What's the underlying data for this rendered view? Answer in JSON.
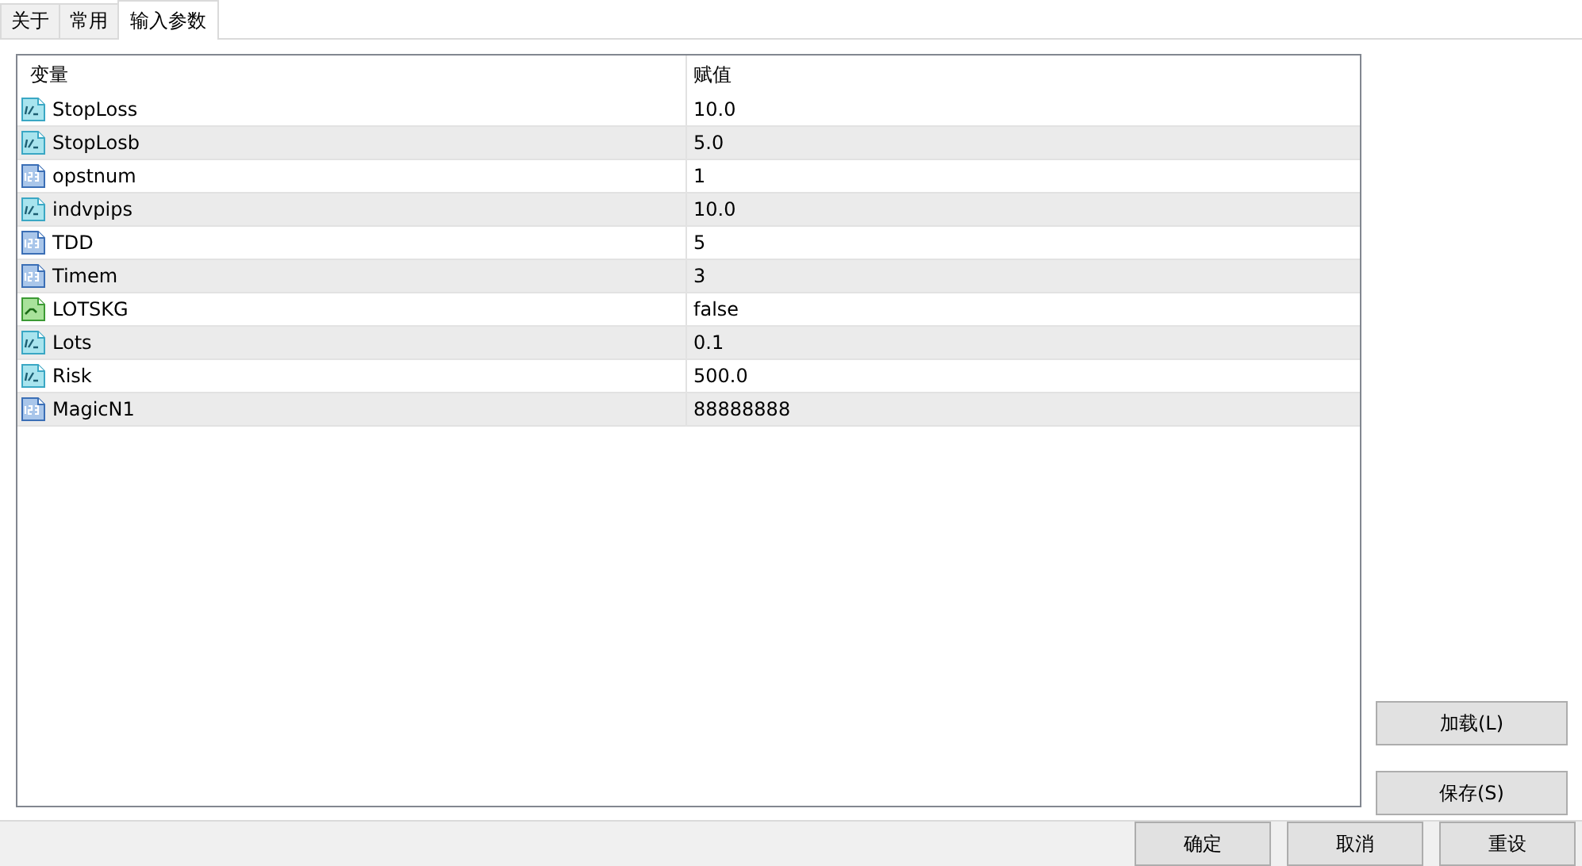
{
  "tabs": [
    {
      "label": "关于",
      "selected": false
    },
    {
      "label": "常用",
      "selected": false
    },
    {
      "label": "输入参数",
      "selected": true
    }
  ],
  "table": {
    "columns": [
      "变量",
      "赋值"
    ],
    "rows": [
      {
        "kind": "double",
        "name": "StopLoss",
        "value": "10.0"
      },
      {
        "kind": "double",
        "name": "StopLosb",
        "value": "5.0"
      },
      {
        "kind": "int",
        "name": "opstnum",
        "value": "1"
      },
      {
        "kind": "double",
        "name": "indvpips",
        "value": "10.0"
      },
      {
        "kind": "int",
        "name": "TDD",
        "value": "5"
      },
      {
        "kind": "int",
        "name": "Timem",
        "value": "3"
      },
      {
        "kind": "bool",
        "name": "LOTSKG",
        "value": "false"
      },
      {
        "kind": "double",
        "name": "Lots",
        "value": "0.1"
      },
      {
        "kind": "double",
        "name": "Risk",
        "value": "500.0"
      },
      {
        "kind": "int",
        "name": "MagicN1",
        "value": "88888888"
      }
    ]
  },
  "side_buttons": [
    "加载(L)",
    "保存(S)"
  ],
  "footer_buttons": [
    "确定",
    "取消",
    "重设"
  ]
}
